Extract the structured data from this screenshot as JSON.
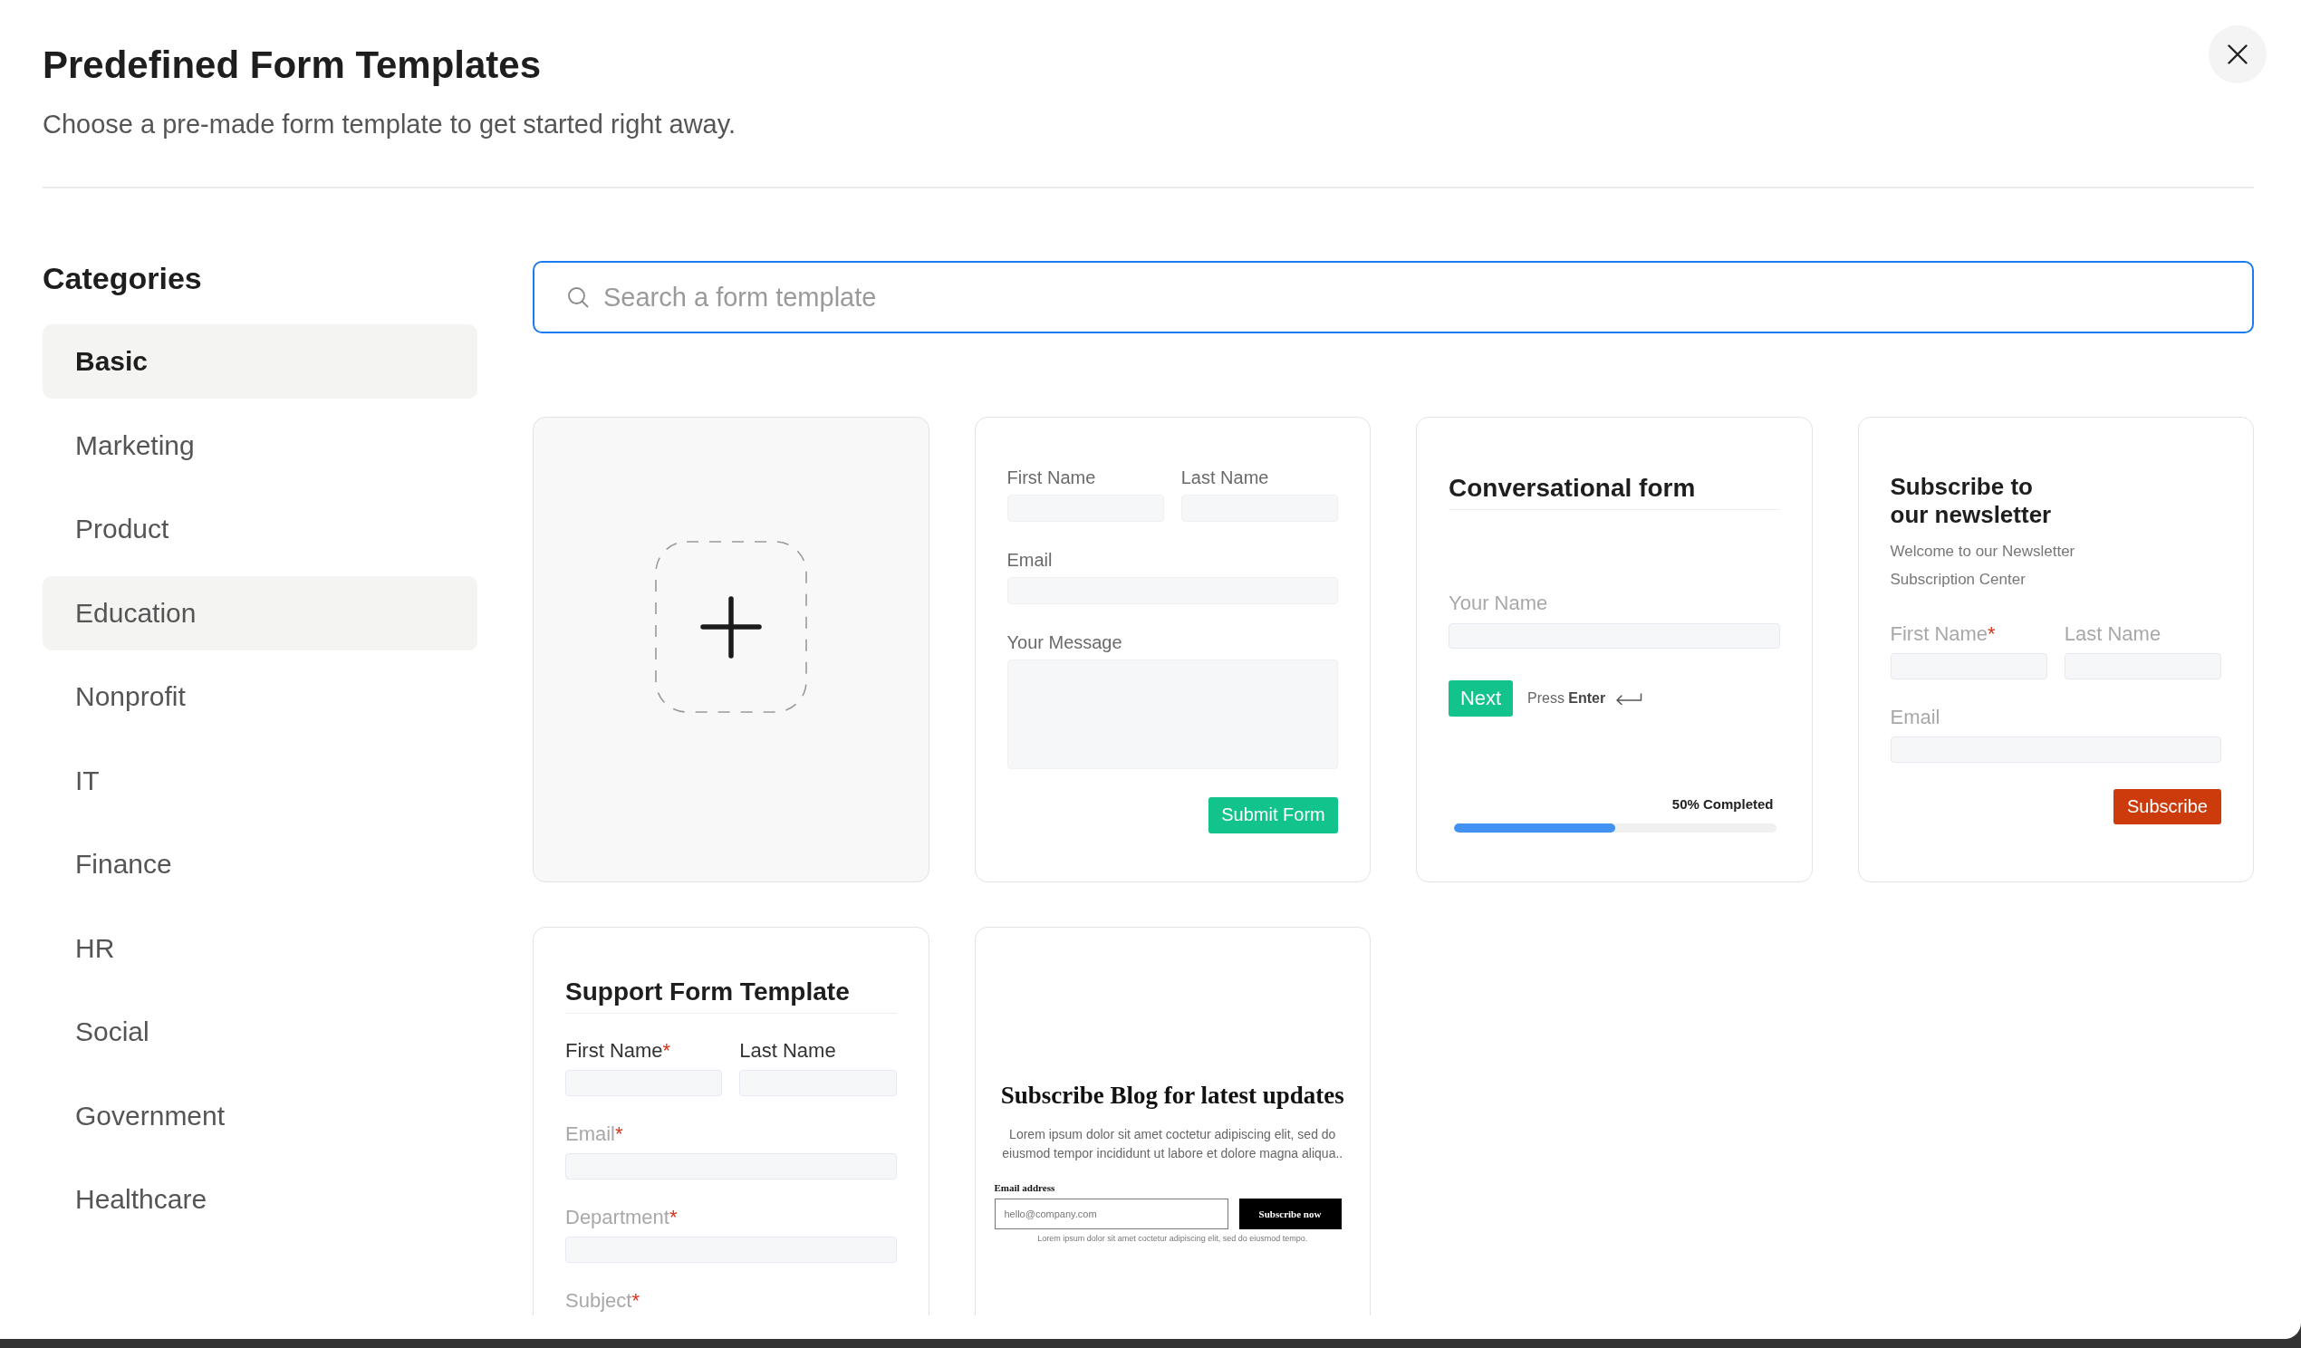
{
  "header": {
    "title": "Predefined Form Templates",
    "subtitle": "Choose a pre-made form template to get started right away."
  },
  "sidebar": {
    "title": "Categories",
    "items": [
      {
        "label": "Basic",
        "selected": true,
        "hovered": false
      },
      {
        "label": "Marketing",
        "selected": false,
        "hovered": false
      },
      {
        "label": "Product",
        "selected": false,
        "hovered": false
      },
      {
        "label": "Education",
        "selected": false,
        "hovered": true
      },
      {
        "label": "Nonprofit",
        "selected": false,
        "hovered": false
      },
      {
        "label": "IT",
        "selected": false,
        "hovered": false
      },
      {
        "label": "Finance",
        "selected": false,
        "hovered": false
      },
      {
        "label": "HR",
        "selected": false,
        "hovered": false
      },
      {
        "label": "Social",
        "selected": false,
        "hovered": false
      },
      {
        "label": "Government",
        "selected": false,
        "hovered": false
      },
      {
        "label": "Healthcare",
        "selected": false,
        "hovered": false
      }
    ]
  },
  "search": {
    "placeholder": "Search a form template"
  },
  "templates": [
    {
      "kind": "blank"
    },
    {
      "kind": "contact",
      "fields": [
        {
          "label": "First Name",
          "kind": "half",
          "muted": false
        },
        {
          "label": "Last Name",
          "kind": "half",
          "muted": false
        },
        {
          "label": "Email",
          "kind": "full",
          "muted": false
        },
        {
          "label": "Your Message",
          "kind": "textarea",
          "muted": false
        }
      ],
      "button": "Submit Form"
    },
    {
      "kind": "conversational",
      "title": "Conversational form",
      "field": "Your Name",
      "button": "Next",
      "hint": "Press **Enter**",
      "progress": {
        "label": "50% Completed",
        "level": 0.5
      }
    },
    {
      "kind": "newsletter",
      "title": "Subscribe to our newsletter",
      "description": "Welcome to our Newsletter Subscription Center",
      "fields": [
        {
          "label": "First Name",
          "mark": "*",
          "kind": "half",
          "muted": true
        },
        {
          "label": "Last Name",
          "kind": "half",
          "muted": true
        },
        {
          "label": "Email",
          "kind": "full",
          "muted": true
        }
      ],
      "button": "Subscribe"
    },
    {
      "kind": "support",
      "title": "Support Form Template",
      "fields": [
        {
          "label": "First Name",
          "mark": "*",
          "kind": "half",
          "muted": false
        },
        {
          "label": "Last Name",
          "kind": "half",
          "muted": false
        },
        {
          "label": "Email",
          "mark": "*",
          "kind": "full",
          "muted": true
        },
        {
          "label": "Department",
          "mark": "*",
          "kind": "full",
          "muted": true
        },
        {
          "label": "Subject",
          "mark": "*",
          "kind": "full",
          "muted": true
        }
      ]
    },
    {
      "kind": "blog",
      "title": "Subscribe Blog for latest updates",
      "text": "Lorem ipsum dolor sit amet coctetur adipiscing elit, sed do eiusmod tempor incididunt ut labore et dolore magna aliqua..",
      "email_label": "Email address",
      "placeholder": "hello@company.com",
      "button": "Subscribe now",
      "note": "Lorem ipsum dolor sit amet coctetur adipiscing elit, sed do eiusmod tempo."
    }
  ]
}
